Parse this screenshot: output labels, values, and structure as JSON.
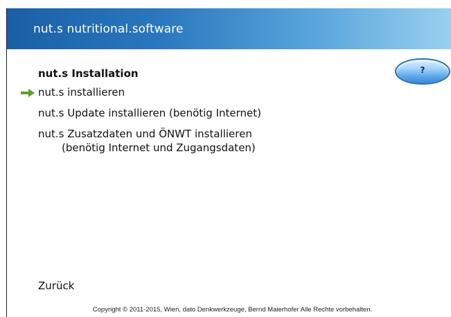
{
  "header": {
    "title": "nut.s nutritional.software"
  },
  "help_button": {
    "label": "?"
  },
  "section": {
    "title": "nut.s Installation"
  },
  "menu": {
    "items": [
      {
        "label": "nut.s installieren",
        "selected": true
      },
      {
        "label": "nut.s Update installieren (benötig Internet)",
        "selected": false
      },
      {
        "label": "nut.s Zusatzdaten und ÖNWT installieren",
        "sublabel": "(benötig Internet und Zugangsdaten)",
        "selected": false
      }
    ]
  },
  "footer": {
    "back_label": "Zurück",
    "copyright": "Copyright © 2011-2015, Wien, dato Denkwerkzeuge, Bernd Maierhofer Alle Rechte vorbehalten."
  },
  "icons": {
    "selected_marker": "arrow-right-icon",
    "arrow_color": "#5aa02c"
  },
  "colors": {
    "header_gradient_start": "#1a5fa6",
    "header_gradient_end": "#9ad0f0",
    "help_button": "#5ea9ea"
  }
}
